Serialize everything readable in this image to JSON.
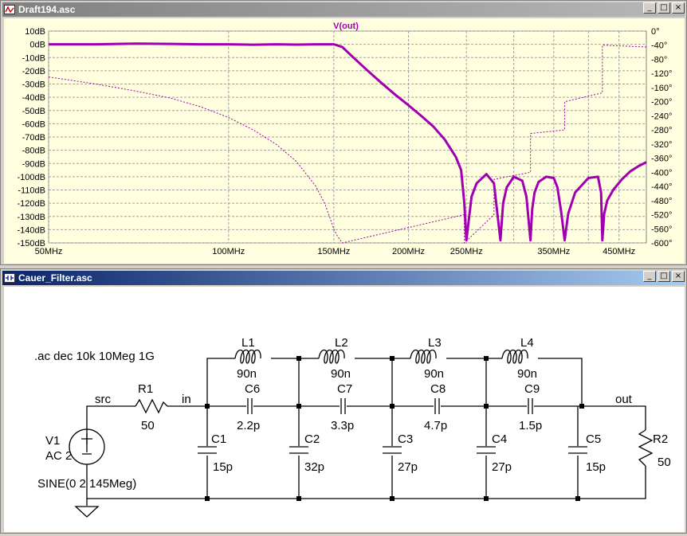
{
  "plot_window": {
    "title": "Draft194.asc",
    "controls": [
      "_",
      "□",
      "×"
    ]
  },
  "schematic_window": {
    "title": "Cauer_Filter.asc",
    "controls": [
      "_",
      "□",
      "×"
    ]
  },
  "colors": {
    "trace": "#a000b0",
    "grid": "#a0a0a0",
    "axis_text": "#000000",
    "schematic_wire": "#000000",
    "plot_bg": "#ffffdf"
  },
  "chart_data": {
    "type": "line",
    "title": "V(out)",
    "x_scale": "log",
    "x_unit": "MHz",
    "xlim": [
      50,
      500
    ],
    "x_ticks": [
      "50MHz",
      "100MHz",
      "150MHz",
      "200MHz",
      "250MHz",
      "350MHz",
      "450MHz"
    ],
    "x_tick_values": [
      50,
      100,
      150,
      200,
      250,
      350,
      450
    ],
    "x_minor_grid_values": [
      300,
      400
    ],
    "y_left_ticks": [
      "10dB",
      "0dB",
      "-10dB",
      "-20dB",
      "-30dB",
      "-40dB",
      "-50dB",
      "-60dB",
      "-70dB",
      "-80dB",
      "-90dB",
      "-100dB",
      "-110dB",
      "-120dB",
      "-130dB",
      "-140dB",
      "-150dB"
    ],
    "ylim_left": [
      -150,
      10
    ],
    "y_right_ticks": [
      "0°",
      "-40°",
      "-80°",
      "-120°",
      "-160°",
      "-200°",
      "-240°",
      "-280°",
      "-320°",
      "-360°",
      "-400°",
      "-440°",
      "-480°",
      "-520°",
      "-560°",
      "-600°"
    ],
    "ylim_right": [
      -600,
      0
    ],
    "grid": true,
    "series": [
      {
        "axis": "left",
        "style": "solid",
        "x": [
          50,
          60,
          70,
          80,
          90,
          100,
          110,
          120,
          130,
          140,
          145,
          150,
          155,
          160,
          170,
          180,
          190,
          200,
          210,
          220,
          230,
          240,
          245,
          248,
          250,
          255,
          260,
          270,
          278,
          282,
          285,
          288,
          292,
          300,
          310,
          315,
          320,
          322,
          325,
          330,
          340,
          350,
          355,
          360,
          365,
          370,
          380,
          400,
          415,
          420,
          422,
          425,
          430,
          440,
          455,
          470,
          485,
          500
        ],
        "values": [
          0,
          0,
          0.5,
          0.3,
          0,
          0,
          -0.3,
          0,
          -0.2,
          0,
          0,
          0,
          -2,
          -8,
          -19,
          -29,
          -38,
          -46,
          -54,
          -62,
          -72,
          -85,
          -95,
          -120,
          -148,
          -115,
          -105,
          -98,
          -105,
          -130,
          -148,
          -120,
          -108,
          -100,
          -103,
          -115,
          -148,
          -125,
          -112,
          -104,
          -100,
          -101,
          -108,
          -126,
          -148,
          -128,
          -112,
          -101,
          -100,
          -112,
          -148,
          -128,
          -118,
          -110,
          -102,
          -96,
          -92,
          -89
        ]
      },
      {
        "axis": "right",
        "style": "dotted",
        "x": [
          50,
          60,
          70,
          80,
          90,
          100,
          110,
          120,
          130,
          140,
          145,
          150,
          152,
          155,
          248,
          248.1,
          278,
          278.1,
          320,
          320.1,
          365,
          365.1,
          422,
          422.1,
          500
        ],
        "values": [
          -130,
          -150,
          -170,
          -190,
          -215,
          -245,
          -280,
          -320,
          -370,
          -440,
          -490,
          -560,
          -580,
          -600,
          -520,
          -600,
          -520,
          -420,
          -400,
          -290,
          -280,
          -200,
          -175,
          -40,
          -45
        ]
      }
    ]
  },
  "schematic": {
    "directive": ".ac dec 10k 10Meg 1G",
    "nets": {
      "src": "src",
      "in": "in",
      "out": "out"
    },
    "source": {
      "name": "V1",
      "value": "AC 2",
      "sine": "SINE(0 2 145Meg)"
    },
    "R1": {
      "name": "R1",
      "value": "50"
    },
    "R2": {
      "name": "R2",
      "value": "50"
    },
    "inductors": [
      {
        "name": "L1",
        "value": "90n"
      },
      {
        "name": "L2",
        "value": "90n"
      },
      {
        "name": "L3",
        "value": "90n"
      },
      {
        "name": "L4",
        "value": "90n"
      }
    ],
    "series_caps": [
      {
        "name": "C6",
        "value": "2.2p"
      },
      {
        "name": "C7",
        "value": "3.3p"
      },
      {
        "name": "C8",
        "value": "4.7p"
      },
      {
        "name": "C9",
        "value": "1.5p"
      }
    ],
    "shunt_caps": [
      {
        "name": "C1",
        "value": "15p"
      },
      {
        "name": "C2",
        "value": "32p"
      },
      {
        "name": "C3",
        "value": "27p"
      },
      {
        "name": "C4",
        "value": "27p"
      },
      {
        "name": "C5",
        "value": "15p"
      }
    ]
  }
}
